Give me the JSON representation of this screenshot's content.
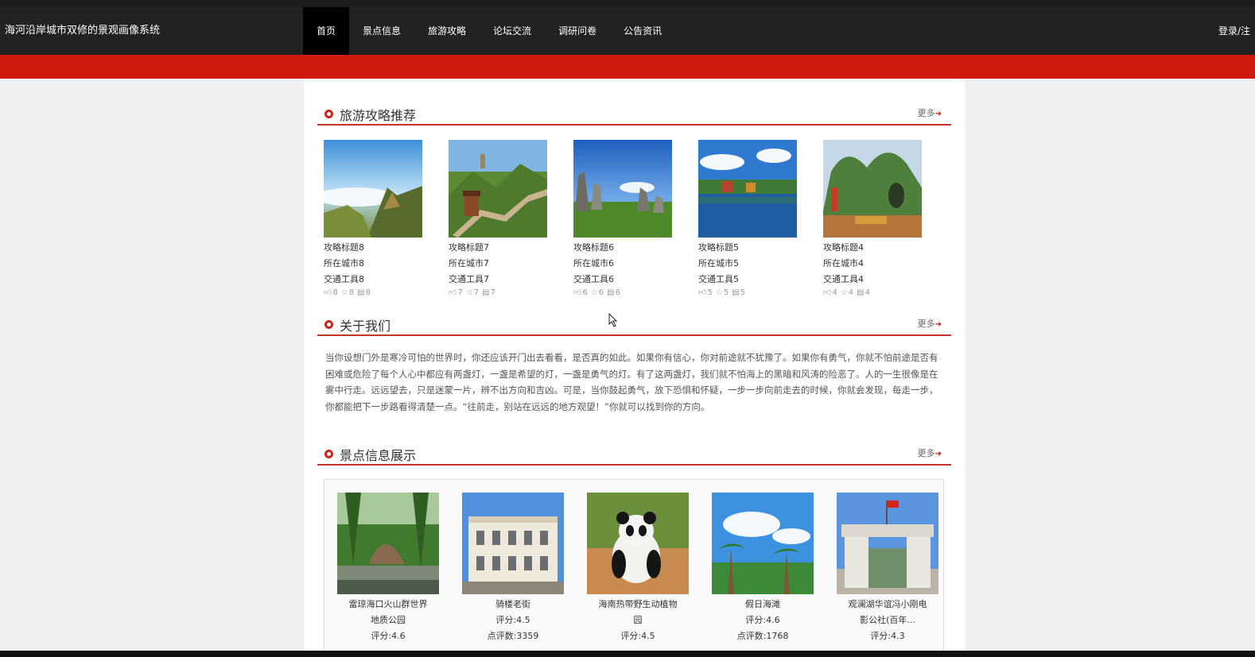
{
  "header": {
    "brand": "海河沿岸城市双修的景观画像系统",
    "nav": [
      "首页",
      "景点信息",
      "旅游攻略",
      "论坛交流",
      "调研问卷",
      "公告资讯"
    ],
    "active_nav_index": 0,
    "login": "登录/注"
  },
  "colors": {
    "accent": "#d0190f",
    "navbar": "#222222"
  },
  "guides_section": {
    "title": "旅游攻略推荐",
    "more": "更多",
    "items": [
      {
        "title": "攻略标题8",
        "city": "所在城市8",
        "transport": "交通工具8",
        "likes": "8",
        "favs": "8",
        "comments": "8",
        "image": "mountain-clouds-photo"
      },
      {
        "title": "攻略标题7",
        "city": "所在城市7",
        "transport": "交通工具7",
        "likes": "7",
        "favs": "7",
        "comments": "7",
        "image": "great-wall-photo"
      },
      {
        "title": "攻略标题6",
        "city": "所在城市6",
        "transport": "交通工具6",
        "likes": "6",
        "favs": "6",
        "comments": "6",
        "image": "stone-forest-photo"
      },
      {
        "title": "攻略标题5",
        "city": "所在城市5",
        "transport": "交通工具5",
        "likes": "5",
        "favs": "5",
        "comments": "5",
        "image": "lake-village-photo"
      },
      {
        "title": "攻略标题4",
        "city": "所在城市4",
        "transport": "交通工具4",
        "likes": "4",
        "favs": "4",
        "comments": "4",
        "image": "karst-hill-photo"
      }
    ]
  },
  "about_section": {
    "title": "关于我们",
    "more": "更多",
    "text": "当你设想门外是寒冷可怕的世界时，你还应该开门出去看看，是否真的如此。如果你有信心，你对前途就不犹豫了。如果你有勇气，你就不怕前途是否有困难或危险了每个人心中都应有两盏灯，一盏是希望的灯，一盏是勇气的灯。有了这两盏灯，我们就不怕海上的黑暗和风涛的险恶了。人的一生很像是在雾中行走。远远望去，只是迷蒙一片，辨不出方向和吉凶。可是，当你鼓起勇气，放下恐惧和怀疑，一步一步向前走去的时候，你就会发现，每走一步，你都能把下一步路看得清楚一点。“往前走，别站在远远的地方观望！”你就可以找到你的方向。"
  },
  "scenic_section": {
    "title": "景点信息展示",
    "more": "更多",
    "items": [
      {
        "lines": [
          "雷琼海口火山群世界",
          "地质公园",
          "评分:4.6"
        ],
        "image": "volcano-park-photo"
      },
      {
        "lines": [
          "骑楼老街",
          "评分:4.5",
          "点评数:3359"
        ],
        "image": "arcade-street-photo"
      },
      {
        "lines": [
          "海南热带野生动植物",
          "园",
          "评分:4.5"
        ],
        "image": "panda-photo"
      },
      {
        "lines": [
          "假日海滩",
          "评分:4.6",
          "点评数:1768"
        ],
        "image": "beach-palms-photo"
      },
      {
        "lines": [
          "观澜湖华谊冯小刚电",
          "影公社(百年...",
          "评分:4.3"
        ],
        "image": "film-gate-photo"
      }
    ]
  }
}
